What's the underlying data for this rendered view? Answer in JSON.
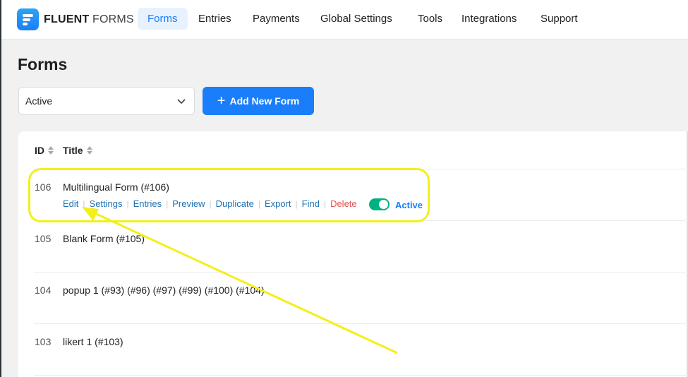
{
  "brand": {
    "bold": "FLUENT",
    "light": "FORMS"
  },
  "nav": [
    {
      "label": "Forms",
      "active": true
    },
    {
      "label": "Entries",
      "active": false
    },
    {
      "label": "Payments",
      "active": false
    },
    {
      "label": "Global Settings",
      "active": false
    },
    {
      "label": "Tools",
      "active": false
    },
    {
      "label": "Integrations",
      "active": false
    },
    {
      "label": "Support",
      "active": false
    }
  ],
  "page_title": "Forms",
  "filter": {
    "selected": "Active"
  },
  "add_button": {
    "label": "Add New Form"
  },
  "table": {
    "columns": [
      "ID",
      "Title"
    ],
    "rows": [
      {
        "id": "106",
        "title": "Multilingual Form (#106)",
        "actions": [
          "Edit",
          "Settings",
          "Entries",
          "Preview",
          "Duplicate",
          "Export",
          "Find",
          "Delete"
        ],
        "status": "Active",
        "enabled": true
      },
      {
        "id": "105",
        "title": "Blank Form (#105)"
      },
      {
        "id": "104",
        "title": "popup 1 (#93) (#96) (#97) (#99) (#100) (#104)"
      },
      {
        "id": "103",
        "title": "likert 1 (#103)"
      }
    ]
  },
  "colors": {
    "accent": "#1a7efb",
    "toggle_on": "#00b27f",
    "delete": "#e15252",
    "annotation": "#f4ef1a"
  }
}
